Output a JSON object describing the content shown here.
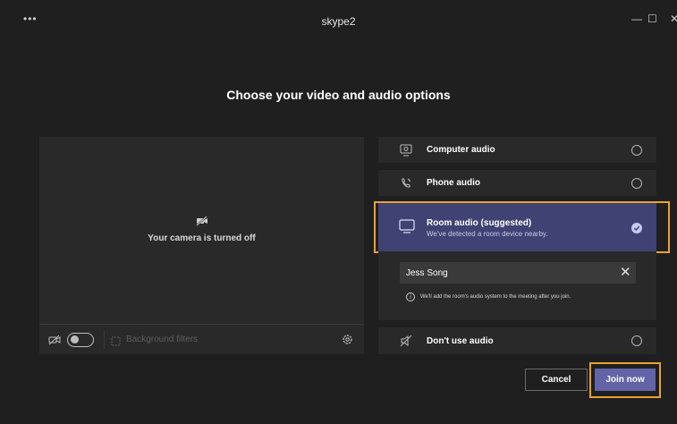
{
  "window": {
    "menu_icon": "more-horizontal-icon",
    "title": "skype2",
    "minimize_label": "—",
    "maximize_label": "☐",
    "close_label": "✕"
  },
  "heading": "Choose your video and audio options",
  "video": {
    "camera_status": "Your camera is turned off",
    "camera_toggle_on": false,
    "background_filters_label": "Background filters"
  },
  "audio_options": [
    {
      "label": "Computer audio",
      "icon": "monitor-speaker-icon",
      "selected": false
    },
    {
      "label": "Phone audio",
      "icon": "phone-icon",
      "selected": false
    },
    {
      "label": "Room audio (suggested)",
      "subtitle": "We've detected a room device nearby.",
      "icon": "room-display-icon",
      "selected": true
    },
    {
      "label": "Don't use audio",
      "icon": "speaker-off-icon",
      "selected": false
    }
  ],
  "room_device": {
    "name": "Jess Song",
    "info": "We'll add the room's audio system to the meeting after you join."
  },
  "buttons": {
    "cancel": "Cancel",
    "join": "Join now"
  },
  "colors": {
    "accent": "#6264a7",
    "highlight": "#e9a233",
    "selected_background": "#3f4272"
  }
}
